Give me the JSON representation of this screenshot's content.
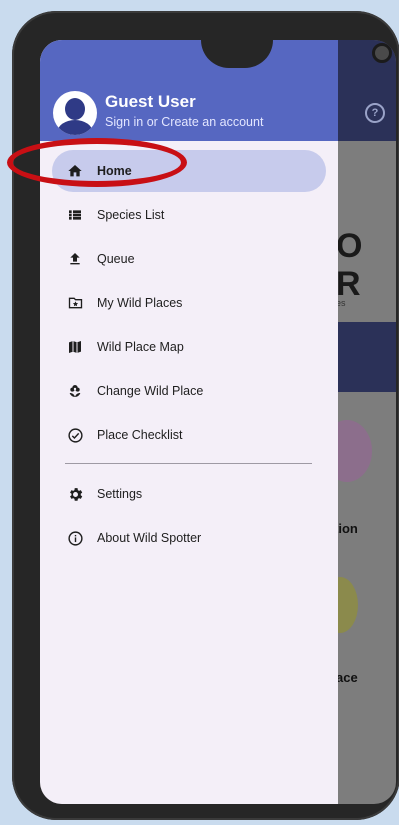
{
  "drawer": {
    "user_name": "Guest User",
    "user_sub": "Sign in or Create an account",
    "items": [
      {
        "label": "Home",
        "icon": "home-icon",
        "active": true
      },
      {
        "label": "Species List",
        "icon": "list-icon"
      },
      {
        "label": "Queue",
        "icon": "upload-icon"
      },
      {
        "label": "My Wild Places",
        "icon": "folder-star-icon"
      },
      {
        "label": "Wild Place Map",
        "icon": "map-icon"
      },
      {
        "label": "Change Wild Place",
        "icon": "flower-icon"
      },
      {
        "label": "Place Checklist",
        "icon": "check-circle-icon"
      }
    ],
    "footer_items": [
      {
        "label": "Settings",
        "icon": "gear-icon"
      },
      {
        "label": "About Wild Spotter",
        "icon": "info-icon"
      }
    ]
  },
  "background": {
    "help_icon": "?",
    "logo_line1": "O",
    "logo_line2": "R",
    "logo_line3": "es",
    "label1": "tion",
    "label2": "ace"
  },
  "colors": {
    "drawer_header": "#5667c1",
    "active_item": "#c7cbec",
    "highlight": "#c80f14",
    "app_header": "#2b3158"
  }
}
